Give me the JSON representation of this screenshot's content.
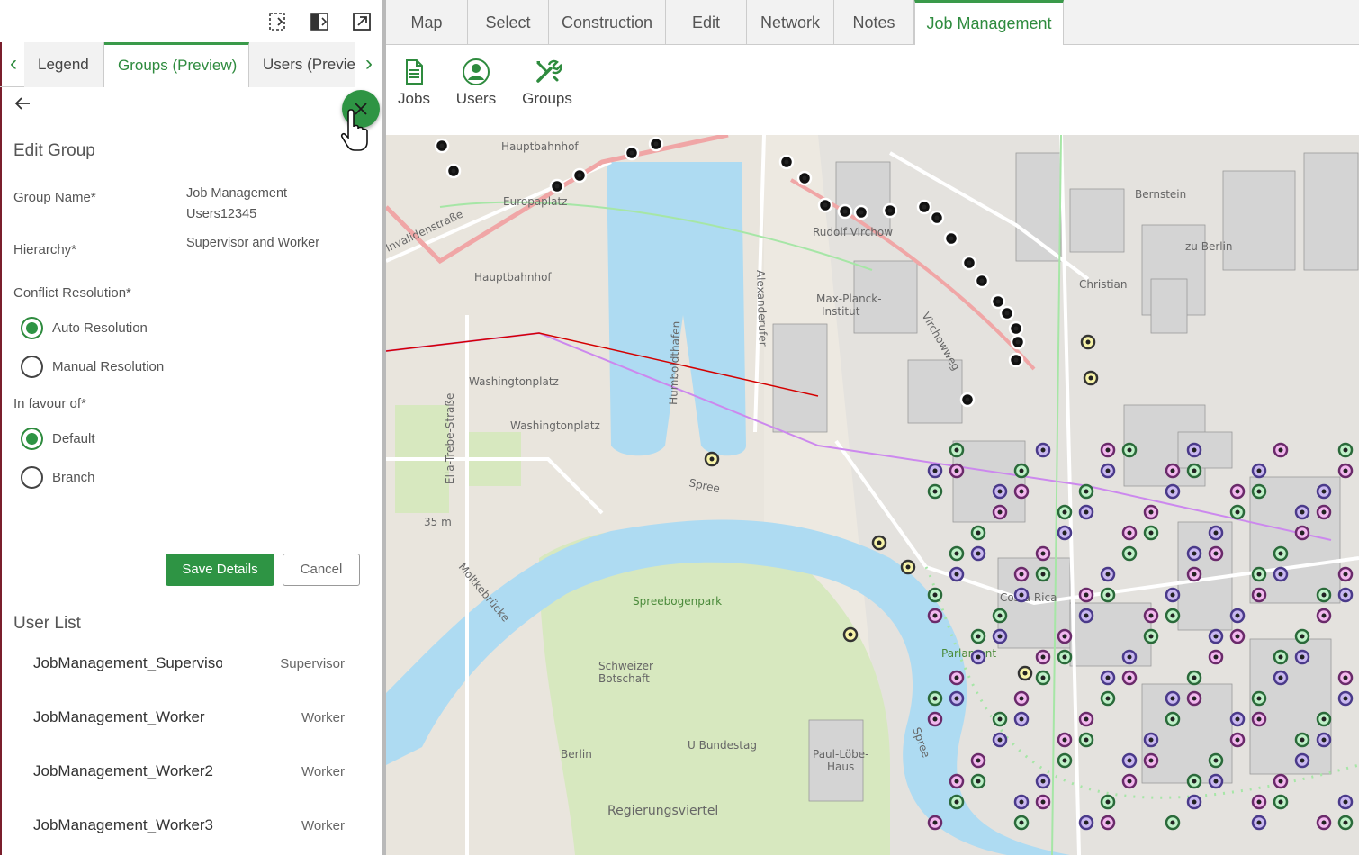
{
  "left_panel": {
    "tabs": [
      {
        "label": "Legend",
        "active": false
      },
      {
        "label": "Groups (Preview)",
        "active": true
      },
      {
        "label": "Users (Preview)",
        "active": false
      }
    ],
    "title": "Edit Group",
    "group_name_label": "Group Name*",
    "group_name_value_line1": "Job Management",
    "group_name_value_line2": "Users12345",
    "hierarchy_label": "Hierarchy*",
    "hierarchy_value": "Supervisor and Worker",
    "conflict_label": "Conflict Resolution*",
    "conflict_options": [
      {
        "label": "Auto Resolution",
        "selected": true
      },
      {
        "label": "Manual Resolution",
        "selected": false
      }
    ],
    "favour_label": "In favour of*",
    "favour_options": [
      {
        "label": "Default",
        "selected": true
      },
      {
        "label": "Branch",
        "selected": false
      }
    ],
    "save_label": "Save Details",
    "cancel_label": "Cancel",
    "user_list_title": "User List",
    "users": [
      {
        "name": "JobManagement_Supervisor",
        "role": "Supervisor"
      },
      {
        "name": "JobManagement_Worker",
        "role": "Worker"
      },
      {
        "name": "JobManagement_Worker2",
        "role": "Worker"
      },
      {
        "name": "JobManagement_Worker3",
        "role": "Worker"
      }
    ]
  },
  "ribbon": {
    "tabs": [
      "Map",
      "Select",
      "Construction",
      "Edit",
      "Network",
      "Notes",
      "Job Management"
    ],
    "active_tab": "Job Management",
    "tools": [
      {
        "label": "Jobs",
        "icon": "document-icon"
      },
      {
        "label": "Users",
        "icon": "user-icon"
      },
      {
        "label": "Groups",
        "icon": "tools-icon"
      }
    ]
  },
  "map": {
    "labels": {
      "hauptbahnhof_top": "Hauptbahnhof",
      "europaplatz": "Europaplatz",
      "invalidenstrasse": "Invalidenstraße",
      "hauptbahnhof": "Hauptbahnhof",
      "washingtonplatz": "Washingtonplatz",
      "washingtonplatz2": "Washingtonplatz",
      "humboldthafen": "Humboldthafen",
      "alexanderufer": "Alexanderufer",
      "rudolf_virchow": "Rudolf Virchow",
      "max_planck": "Max-Planck-",
      "institut": "Institut",
      "virchowweg": "Virchowweg",
      "spree": "Spree",
      "spree2": "Spree",
      "ella_trebe": "Ella-Trebe-Straße",
      "elevation": "35 m",
      "spreebogenpark": "Spreebogenpark",
      "moltkebrucke": "Moltkebrücke",
      "schweizer": "Schweizer",
      "botschaft": "Botschaft",
      "berlin": "Berlin",
      "u_bundestag": "U Bundestag",
      "paul_lobe": "Paul-Löbe-",
      "haus": "Haus",
      "regierungsviertel": "Regierungsviertel",
      "parlament": "Parlament",
      "costa_rica": "Costa Rica",
      "bernstein": "Bernstein",
      "berlin2": "zu Berlin",
      "christian": "Christian"
    }
  },
  "colors": {
    "accent": "#2e8b3e",
    "water": "#aedbf2",
    "park": "#d7e8bf",
    "rail_pink": "#f0a6a6"
  }
}
